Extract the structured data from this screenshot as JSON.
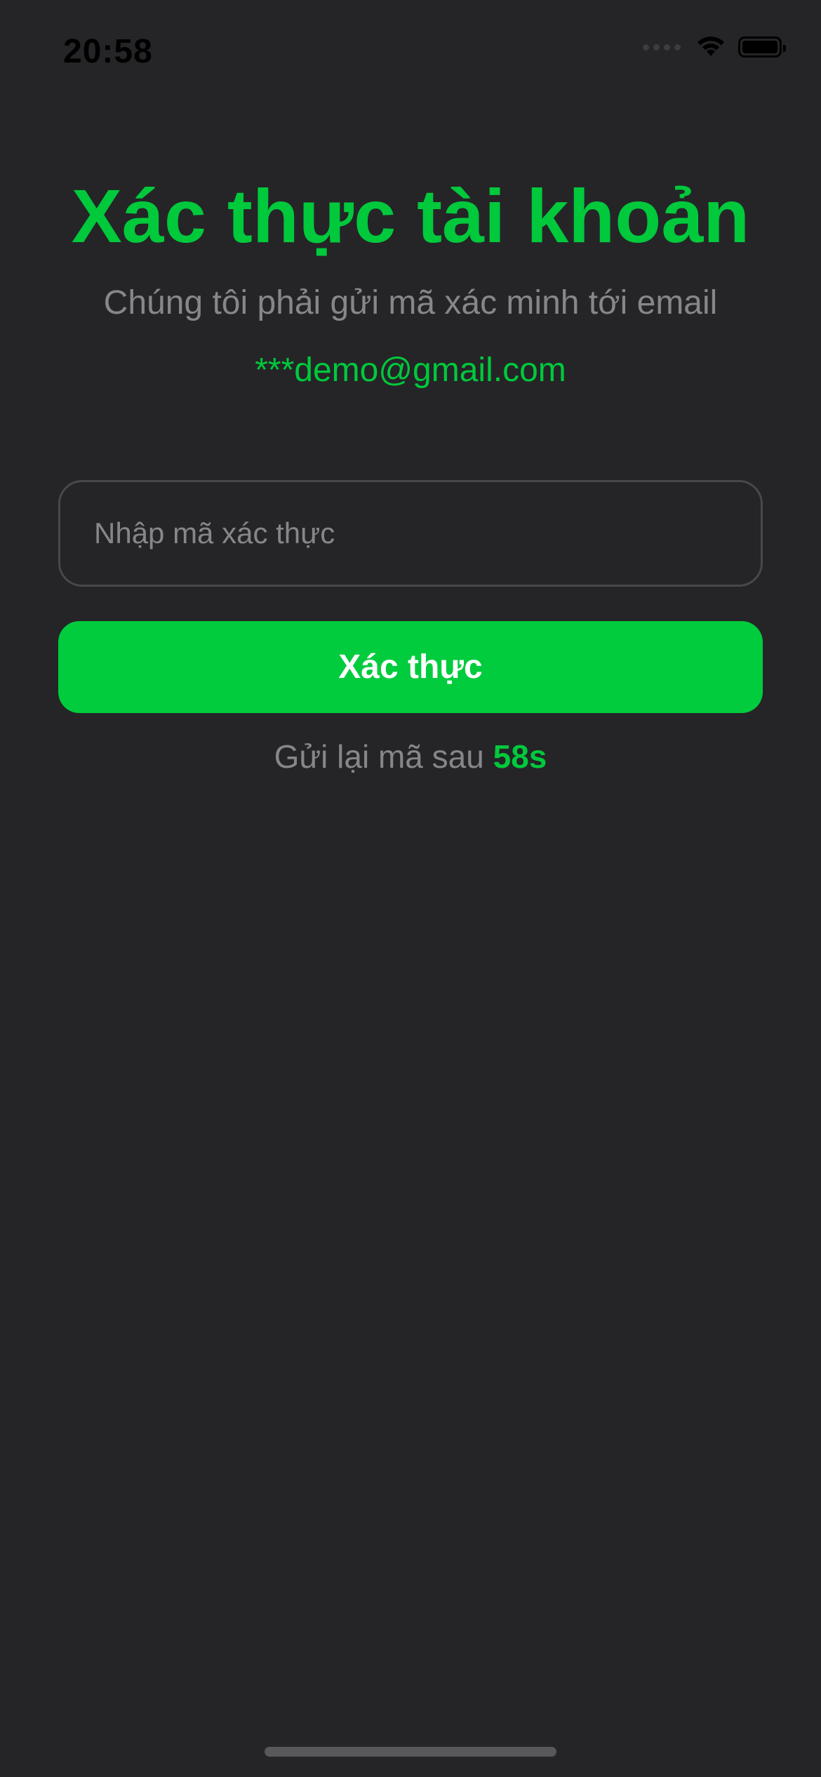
{
  "status_bar": {
    "time": "20:58",
    "icons": [
      "cellular-signal-icon",
      "wifi-icon",
      "battery-icon"
    ],
    "battery_level": 1.0
  },
  "header": {
    "title": "Xác thực tài khoản",
    "subtitle": "Chúng tôi phải gửi mã xác minh tới email",
    "email": "***demo@gmail.com"
  },
  "form": {
    "code_value": "",
    "code_placeholder": "Nhập mã xác thực",
    "submit_label": "Xác thực"
  },
  "resend": {
    "label": "Gửi lại mã sau",
    "countdown": "58s"
  },
  "colors": {
    "accent": "#00C93C",
    "background": "#252527",
    "secondary_text": "#86868B",
    "input_border": "#48484B"
  }
}
